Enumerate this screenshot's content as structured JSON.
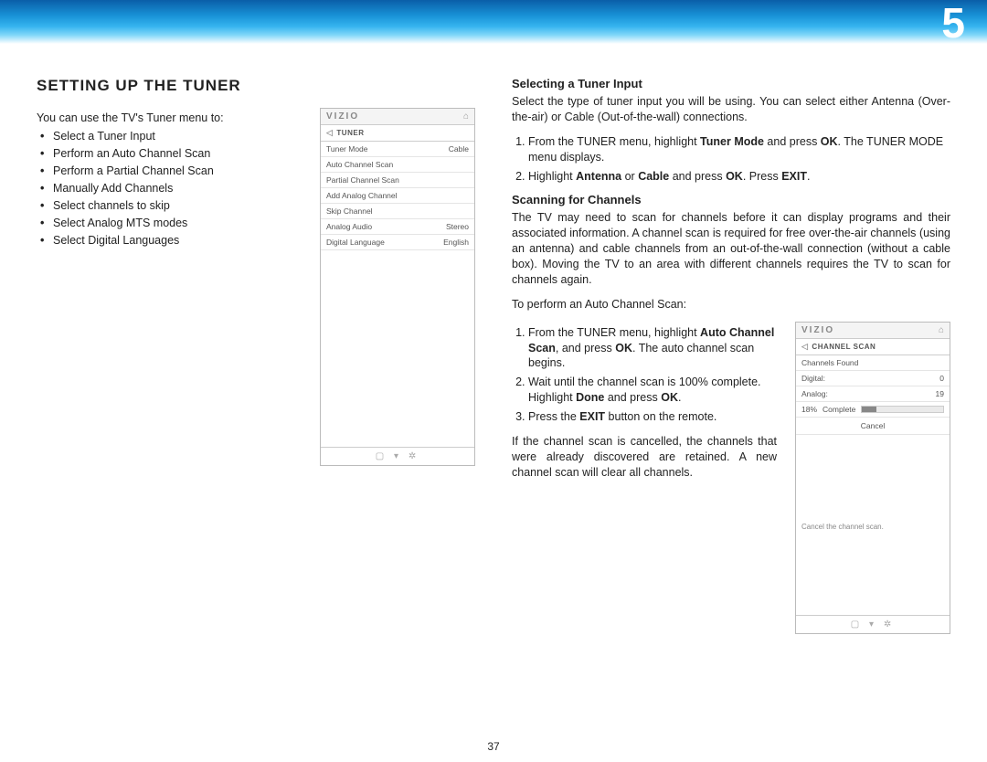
{
  "chapter_number": "5",
  "page_number": "37",
  "section_heading": "SETTING UP THE TUNER",
  "intro_line": "You can use the TV's Tuner menu to:",
  "bullets": {
    "b0": "Select a Tuner Input",
    "b1": "Perform an Auto Channel Scan",
    "b2": "Perform a Partial Channel Scan",
    "b3": "Manually Add Channels",
    "b4": "Select channels to skip",
    "b5": "Select Analog MTS modes",
    "b6": "Select Digital Languages"
  },
  "osd1": {
    "brand": "VIZIO",
    "title": "TUNER",
    "rows": {
      "r0": {
        "label": "Tuner Mode",
        "value": "Cable"
      },
      "r1": {
        "label": "Auto Channel Scan",
        "value": ""
      },
      "r2": {
        "label": "Partial Channel Scan",
        "value": ""
      },
      "r3": {
        "label": "Add Analog Channel",
        "value": ""
      },
      "r4": {
        "label": "Skip Channel",
        "value": ""
      },
      "r5": {
        "label": "Analog Audio",
        "value": "Stereo"
      },
      "r6": {
        "label": "Digital Language",
        "value": "English"
      }
    },
    "foot": "▢  ▾  ✲"
  },
  "right": {
    "sub1_title": "Selecting a Tuner Input",
    "sub1_body": "Select the type of tuner input you will be using. You can select either Antenna (Over-the-air) or Cable (Out-of-the-wall) connections.",
    "step1a_pre": "From the TUNER menu, highlight ",
    "step1a_bold1": "Tuner Mode",
    "step1a_mid": " and press ",
    "step1a_bold2": "OK",
    "step1a_post": ". The TUNER MODE menu displays.",
    "step1b_pre": "Highlight ",
    "step1b_bold1": "Antenna",
    "step1b_mid1": " or ",
    "step1b_bold2": "Cable",
    "step1b_mid2": " and press ",
    "step1b_bold3": "OK",
    "step1b_mid3": ". Press ",
    "step1b_bold4": "EXIT",
    "step1b_post": ".",
    "sub2_title": "Scanning for Channels",
    "sub2_body": "The TV may need to scan for channels before it can display programs and their associated information. A channel scan is required for free over-the-air channels (using an antenna) and cable channels from an out-of-the-wall connection (without a cable box). Moving the TV to an area with different channels requires the TV to scan for channels again.",
    "sub2_lead": "To perform an Auto Channel Scan:",
    "step2a_pre": "From the TUNER menu, highlight ",
    "step2a_bold1": "Auto Channel Scan",
    "step2a_mid": ", and press ",
    "step2a_bold2": "OK",
    "step2a_post": ". The auto channel scan begins.",
    "step2b_pre": "Wait until the channel scan is 100% complete. Highlight ",
    "step2b_bold1": "Done",
    "step2b_mid": " and press ",
    "step2b_bold2": "OK",
    "step2b_post": ".",
    "step2c_pre": "Press the ",
    "step2c_bold1": "EXIT",
    "step2c_post": " button on the remote.",
    "sub2_tail": "If the channel scan is cancelled, the channels that were already discovered are retained. A new channel scan will clear all channels."
  },
  "osd2": {
    "brand": "VIZIO",
    "title": "CHANNEL SCAN",
    "rows": {
      "r0": {
        "label": "Channels Found",
        "value": ""
      },
      "r1": {
        "label": "Digital:",
        "value": "0"
      },
      "r2": {
        "label": "Analog:",
        "value": "19"
      }
    },
    "progress_pct": "18%",
    "progress_label": "Complete",
    "cancel_label": "Cancel",
    "hint": "Cancel the channel scan.",
    "foot": "▢  ▾  ✲"
  }
}
